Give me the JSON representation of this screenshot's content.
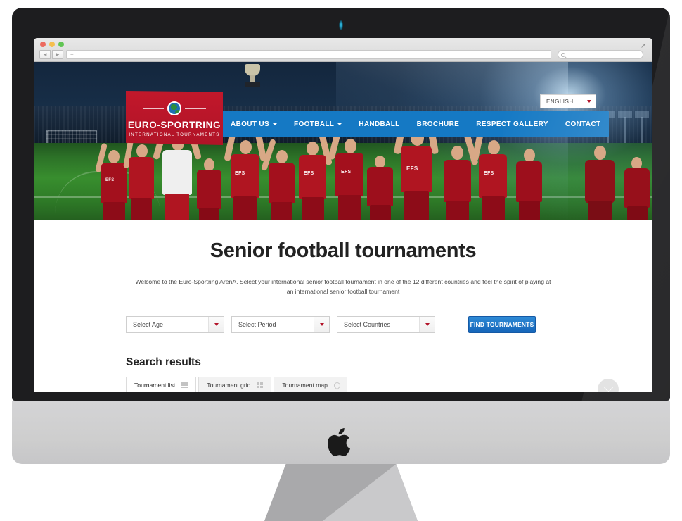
{
  "device": {
    "name": "iMac",
    "brand_icon": "apple-logo"
  },
  "browser": {
    "address_value": "+",
    "search_placeholder": "",
    "traffic_lights": [
      "close",
      "minimize",
      "zoom"
    ],
    "back_icon": "back-arrow-icon",
    "forward_icon": "forward-arrow-icon",
    "search_icon": "search-icon",
    "resize_icon": "resize-handle-icon"
  },
  "site": {
    "logo": {
      "name": "EURO-SPORTRING",
      "tagline": "INTERNATIONAL TOURNAMENTS",
      "icon": "globe-icon"
    },
    "language": {
      "label": "ENGLISH",
      "caret_icon": "caret-down-icon"
    },
    "nav": [
      {
        "label": "ABOUT US",
        "has_dropdown": true
      },
      {
        "label": "FOOTBALL",
        "has_dropdown": true
      },
      {
        "label": "HANDBALL",
        "has_dropdown": false
      },
      {
        "label": "BROCHURE",
        "has_dropdown": false
      },
      {
        "label": "RESPECT GALLERY",
        "has_dropdown": false
      },
      {
        "label": "CONTACT",
        "has_dropdown": false
      }
    ],
    "hero": {
      "alt": "Celebrating football team in red EFS kit holding trophy on floodlit pitch"
    }
  },
  "page": {
    "title": "Senior football tournaments",
    "intro": "Welcome to the Euro-Sportring ArenA. Select your international senior football tournament in one of the 12 different countries and feel the spirit of playing at an international senior football tournament",
    "filters": [
      {
        "name": "age",
        "value": "Select Age"
      },
      {
        "name": "period",
        "value": "Select Period"
      },
      {
        "name": "countries",
        "value": "Select Countries"
      }
    ],
    "submit_label": "FIND TOURNAMENTS",
    "results_heading": "Search results",
    "tabs": [
      {
        "label": "Tournament list",
        "icon": "list-icon",
        "active": true
      },
      {
        "label": "Tournament grid",
        "icon": "grid-icon",
        "active": false
      },
      {
        "label": "Tournament map",
        "icon": "map-pin-icon",
        "active": false
      }
    ],
    "scroll_button_icon": "chevron-down-icon"
  },
  "colors": {
    "brand_red": "#c2182b",
    "brand_blue": "#1579c4",
    "button_blue": "#1565b9",
    "accent_caret_red": "#b3152a"
  }
}
